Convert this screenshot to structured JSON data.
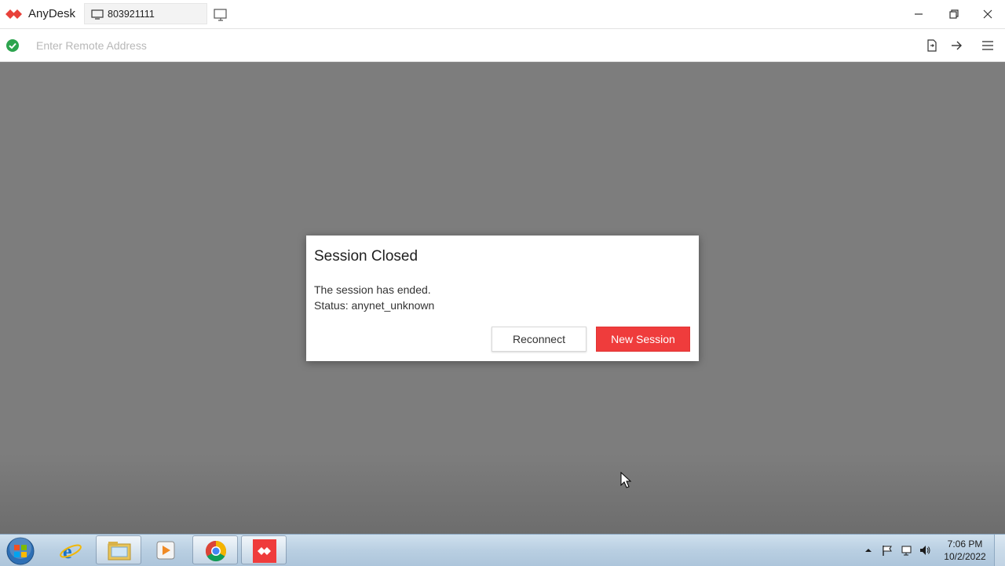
{
  "app": {
    "name": "AnyDesk",
    "brand_color": "#ef3c3c"
  },
  "tabs": [
    {
      "label": "803921111",
      "icon": "monitor-icon"
    }
  ],
  "address_bar": {
    "placeholder": "Enter Remote Address",
    "value": "",
    "status_icon": "check-circle-icon"
  },
  "dialog": {
    "title": "Session Closed",
    "message": "The session has ended.",
    "status": "Status: anynet_unknown",
    "reconnect_label": "Reconnect",
    "new_session_label": "New Session"
  },
  "taskbar": {
    "items": [
      "internet-explorer-icon",
      "file-explorer-icon",
      "media-player-icon",
      "chrome-icon",
      "anydesk-icon"
    ],
    "clock_time": "7:06 PM",
    "clock_date": "10/2/2022"
  }
}
